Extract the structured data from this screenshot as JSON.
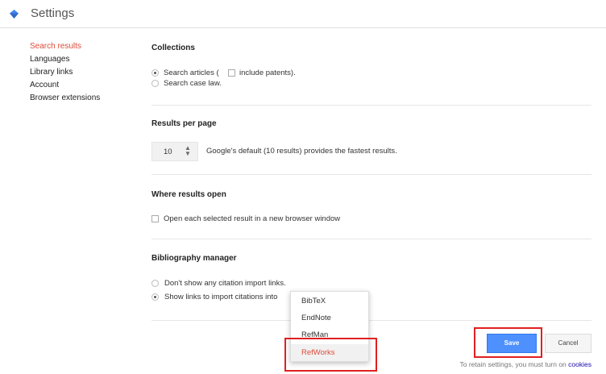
{
  "header": {
    "title": "Settings"
  },
  "sidebar": {
    "items": [
      {
        "label": "Search results"
      },
      {
        "label": "Languages"
      },
      {
        "label": "Library links"
      },
      {
        "label": "Account"
      },
      {
        "label": "Browser extensions"
      }
    ],
    "active_item": "Search results"
  },
  "collections": {
    "title": "Collections",
    "option_articles_prefix": "Search articles (",
    "option_articles_suffix": "include patents).",
    "option_case_law": "Search case law.",
    "selected": "Search articles"
  },
  "results_per_page": {
    "title": "Results per page",
    "value": "10",
    "hint": "Google's default (10 results) provides the fastest results."
  },
  "where_results_open": {
    "title": "Where results open",
    "option_new_window": "Open each selected result in a new browser window"
  },
  "bibliography": {
    "title": "Bibliography manager",
    "option_none": "Don't show any citation import links.",
    "option_show": "Show links to import citations into",
    "selected": "Show links to import citations into",
    "dropdown_options": [
      "BibTeX",
      "EndNote",
      "RefMan",
      "RefWorks"
    ],
    "dropdown_selected": "RefWorks"
  },
  "actions": {
    "save_label": "Save",
    "cancel_label": "Cancel"
  },
  "footer": {
    "text": "To retain settings, you must turn on",
    "link": "cookies"
  },
  "colors": {
    "accent_red": "#dd4b39",
    "save_blue": "#4d90fe",
    "highlight_red": "#e02020",
    "link_blue": "#1a0dab"
  }
}
